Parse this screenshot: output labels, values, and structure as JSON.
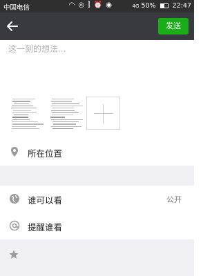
{
  "status_bar": {
    "carrier": "中国电信",
    "icons": "ᯤ ◎",
    "right_icons": "◠ ◎ ⫿ ⏰ ◉",
    "network": "4G",
    "battery": "50%",
    "time": "22:47"
  },
  "title_bar": {
    "back_icon": "arrow-left-icon",
    "send_label": "发送",
    "send_color": "#1aad19"
  },
  "composer": {
    "placeholder": "这一刻的想法..."
  },
  "photos": {
    "add_icon": "plus-icon"
  },
  "location": {
    "label": "所在位置",
    "icon": "location-pin-icon"
  },
  "visibility": {
    "label": "谁可以看",
    "value": "公开",
    "icon": "globe-icon"
  },
  "remind": {
    "label": "提醒谁看",
    "icon": "at-icon"
  },
  "star": {
    "icon": "star-icon"
  }
}
